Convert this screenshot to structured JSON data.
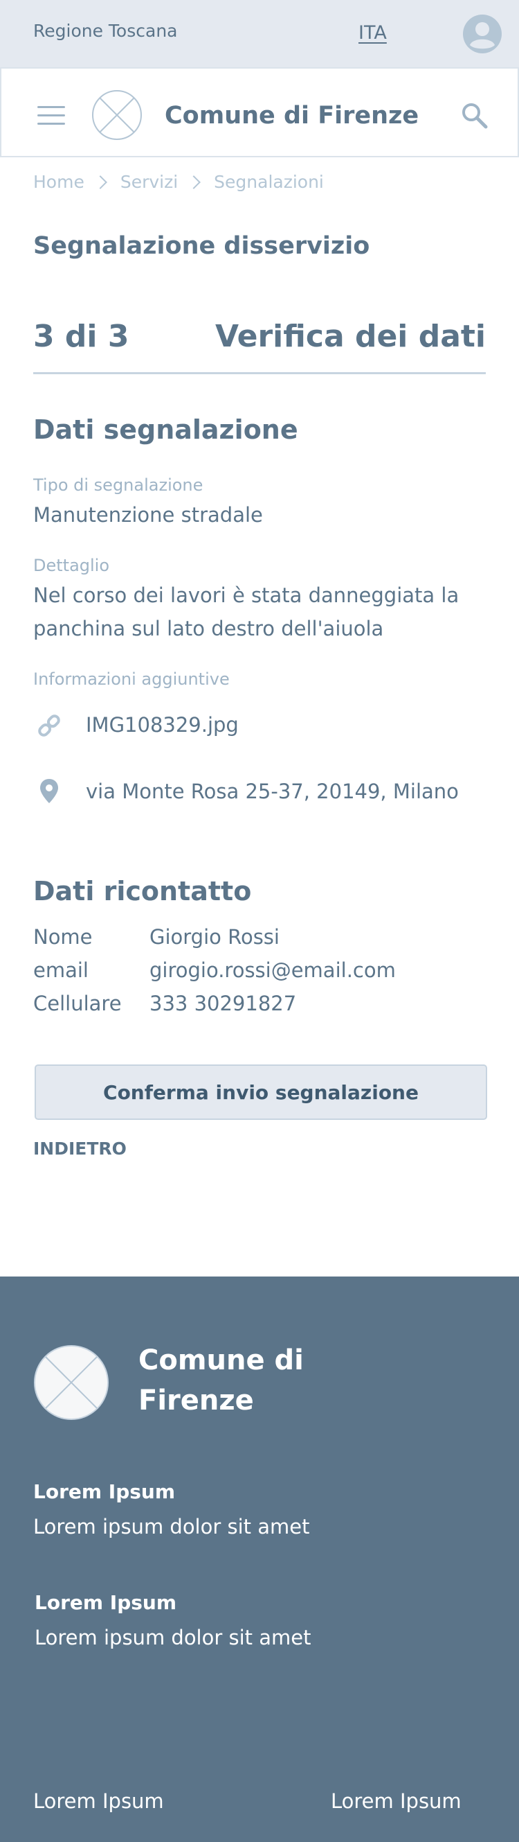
{
  "topbar": {
    "region": "Regione Toscana",
    "language": "ITA",
    "user_icon": "user-avatar-icon"
  },
  "header": {
    "title": "Comune di Firenze",
    "menu_icon": "hamburger-icon",
    "search_icon": "search-icon"
  },
  "breadcrumb": [
    "Home",
    "Servizi",
    "Segnalazioni"
  ],
  "page_title": "Segnalazione disservizio",
  "step": {
    "counter": "3 di 3",
    "name": "Verifica dei dati"
  },
  "report": {
    "section_title": "Dati segnalazione",
    "type_label": "Tipo di segnalazione",
    "type_value": "Manutenzione stradale",
    "detail_label": "Dettaglio",
    "detail_line1": "Nel corso dei lavori è stata danneggiata la",
    "detail_line2": "panchina sul lato destro dell'aiuola",
    "extra_label": "Informazioni aggiuntive",
    "attachment": "IMG108329.jpg",
    "location": "via Monte Rosa 25-37, 20149, Milano"
  },
  "contact": {
    "section_title": "Dati ricontatto",
    "rows": [
      {
        "label": "Nome",
        "value": "Giorgio Rossi"
      },
      {
        "label": "email",
        "value": "girogio.rossi@email.com"
      },
      {
        "label": "Cellulare",
        "value": "333 30291827"
      }
    ]
  },
  "actions": {
    "confirm": "Conferma invio segnalazione",
    "back": "INDIETRO"
  },
  "footer": {
    "title": "Comune di Firenze",
    "block1_head": "Lorem Ipsum",
    "block1_text": "Lorem ipsum dolor sit amet",
    "block2_head": "Lorem Ipsum",
    "block2_text": "Lorem ipsum dolor sit amet",
    "link_left": "Lorem Ipsum",
    "link_right": "Lorem Ipsum"
  },
  "colors": {
    "primary": "#5b7489",
    "muted": "#9fb4c6",
    "topbar_bg": "#e4e9f0",
    "footer_bg": "#5b7489"
  }
}
